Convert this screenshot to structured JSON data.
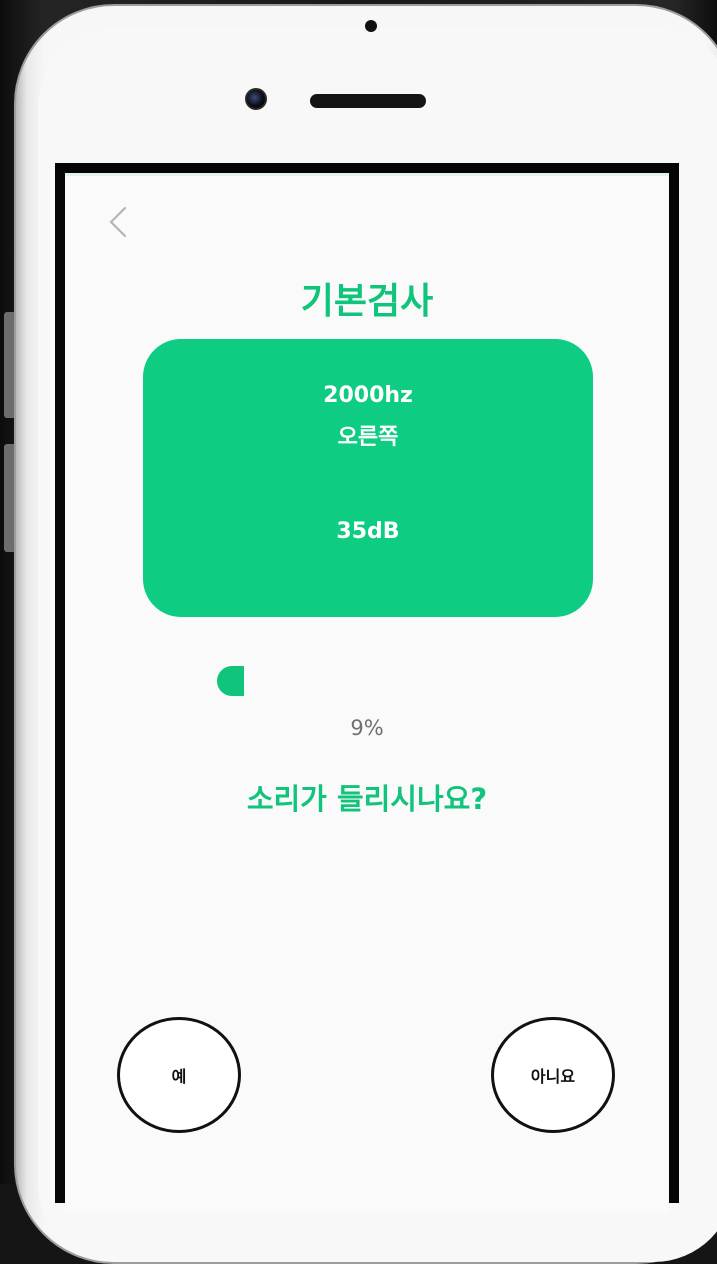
{
  "header": {
    "back_icon": "chevron-left-icon",
    "title": "기본검사"
  },
  "test_card": {
    "frequency": "2000hz",
    "ear": "오른쪽",
    "level": "35dB",
    "color": "#0ecc82"
  },
  "progress": {
    "value": 0.09,
    "label": "9%",
    "fill_color": "#11c47c"
  },
  "question": "소리가 들리시나요?",
  "buttons": {
    "yes_label": "예",
    "no_label": "아니요"
  },
  "colors": {
    "accent": "#11c47c",
    "screen_background": "#fafafa",
    "percent_text": "#707070"
  }
}
